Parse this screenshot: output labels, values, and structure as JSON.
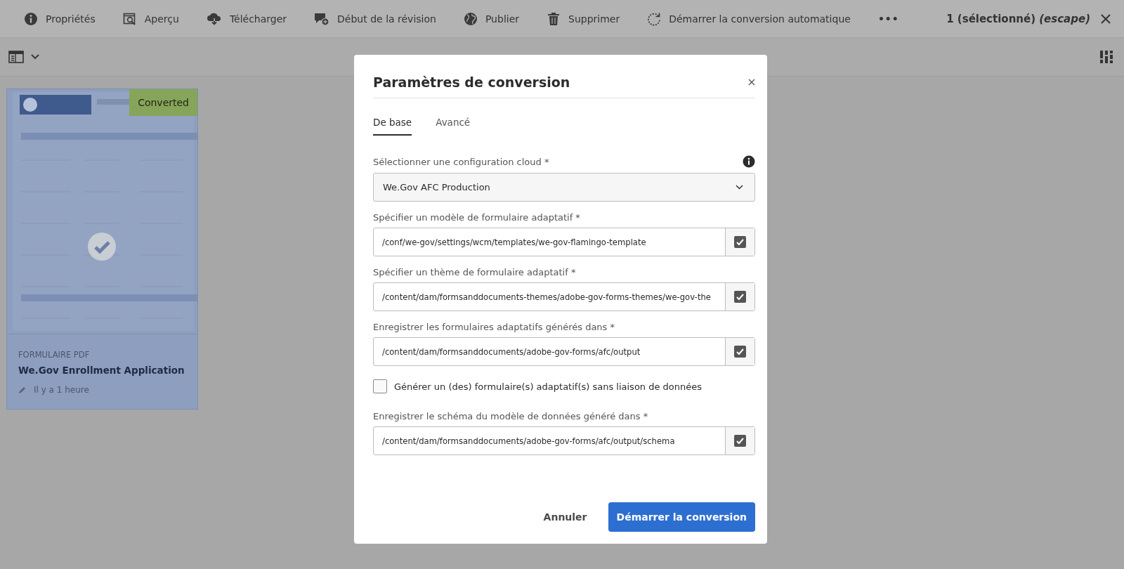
{
  "toolbar": {
    "actions": [
      {
        "kind": "info",
        "label": "Propriétés"
      },
      {
        "kind": "preview",
        "label": "Aperçu"
      },
      {
        "kind": "download",
        "label": "Télécharger"
      },
      {
        "kind": "review",
        "label": "Début de la révision"
      },
      {
        "kind": "globe",
        "label": "Publier"
      },
      {
        "kind": "trash",
        "label": "Supprimer"
      },
      {
        "kind": "refresh",
        "label": "Démarrer la conversion automatique"
      }
    ],
    "more": "•••",
    "selection": "1 (sélectionné) *(escape)*"
  },
  "card": {
    "selected": true,
    "badge": "Converted",
    "type": "FORMULAIRE PDF",
    "title": "We.Gov Enrollment Application",
    "modified": "Il y a 1 heure"
  },
  "dialog": {
    "title": "Paramètres de conversion",
    "tabs": [
      {
        "label": "De base",
        "selected": true
      },
      {
        "label": "Avancé",
        "selected": false
      }
    ],
    "fields": [
      {
        "kind": "select",
        "label": "Sélectionner une configuration cloud *",
        "value": "We.Gov AFC Production"
      },
      {
        "kind": "path",
        "label": "Spécifier un modèle de formulaire adaptatif *",
        "value": "/conf/we-gov/settings/wcm/templates/we-gov-flamingo-template",
        "checked": true
      },
      {
        "kind": "path",
        "label": "Spécifier un thème de formulaire adaptatif *",
        "value": "/content/dam/formsanddocuments-themes/adobe-gov-forms-themes/we-gov-the",
        "checked": true
      },
      {
        "kind": "path",
        "label": "Enregistrer les formulaires adaptatifs générés dans *",
        "value": "/content/dam/formsanddocuments/adobe-gov-forms/afc/output",
        "checked": true
      },
      {
        "kind": "checkbox",
        "label": "Générer un (des) formulaire(s) adaptatif(s) sans liaison de données",
        "checked": false
      },
      {
        "kind": "path",
        "label": "Enregistrer le schéma du modèle de données généré dans *",
        "value": "/content/dam/formsanddocuments/adobe-gov-forms/afc/output/schema",
        "checked": true
      }
    ],
    "cancel": "Annuler",
    "submit": "Démarrer la conversion"
  }
}
